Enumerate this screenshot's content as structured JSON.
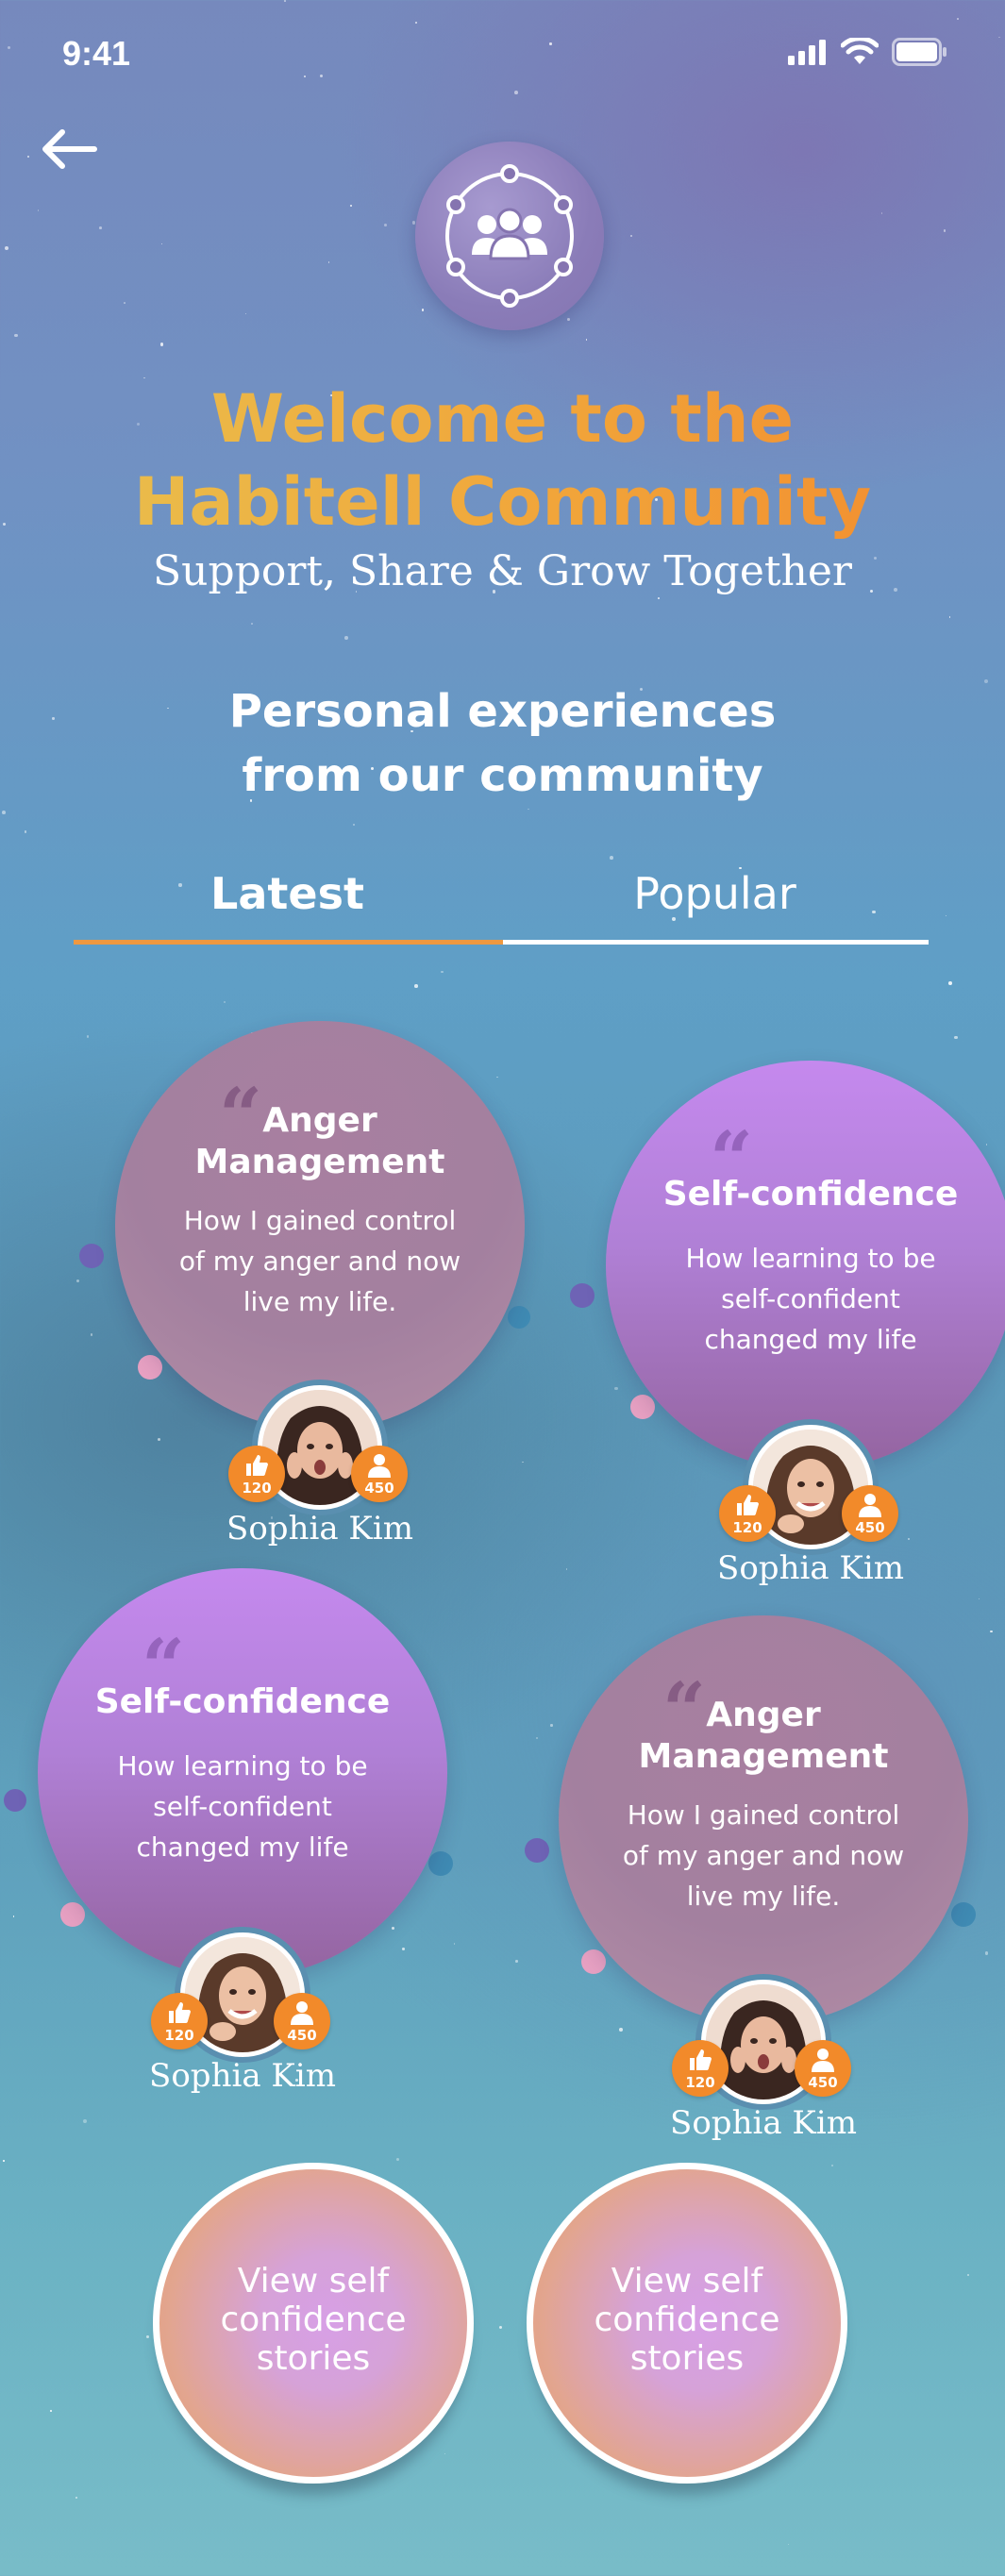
{
  "status_bar": {
    "time": "9:41"
  },
  "header": {
    "title_line1": "Welcome to the",
    "title_line2": "Habitell Community",
    "subtitle": "Support, Share & Grow Together"
  },
  "section": {
    "title_line1": "Personal experiences",
    "title_line2": "from our community"
  },
  "tabs": [
    {
      "label": "Latest",
      "active": true
    },
    {
      "label": "Popular",
      "active": false
    }
  ],
  "posts": [
    {
      "title_line1": "Anger",
      "title_line2": "Management",
      "text_lines": [
        "How I gained control",
        "of my anger and now",
        "live my life."
      ],
      "author": "Sophia Kim",
      "likes": "120",
      "followers": "450"
    },
    {
      "title_line1": "Self-confidence",
      "text_lines": [
        "How learning to be",
        "self-confident",
        "changed my life"
      ],
      "author": "Sophia Kim",
      "likes": "120",
      "followers": "450"
    },
    {
      "title_line1": "Self-confidence",
      "text_lines": [
        "How learning to be",
        "self-confident",
        "changed my life"
      ],
      "author": "Sophia Kim",
      "likes": "120",
      "followers": "450"
    },
    {
      "title_line1": "Anger",
      "title_line2": "Management",
      "text_lines": [
        "How I gained control",
        "of my anger and now",
        "live my life."
      ],
      "author": "Sophia Kim",
      "likes": "120",
      "followers": "450"
    }
  ],
  "cta_buttons": [
    {
      "lines": [
        "View self",
        "confidence",
        "stories"
      ]
    },
    {
      "lines": [
        "View self",
        "confidence",
        "stories"
      ]
    }
  ],
  "colors": {
    "accent_orange": "#f28a2a",
    "title_gold": "#e8c24f",
    "anger_bubble": "#a3809f",
    "confidence_bubble": "#b080d6"
  },
  "icons": [
    "back-arrow-icon",
    "community-icon",
    "like-icon",
    "follower-icon",
    "cellular-icon",
    "wifi-icon",
    "battery-icon"
  ]
}
